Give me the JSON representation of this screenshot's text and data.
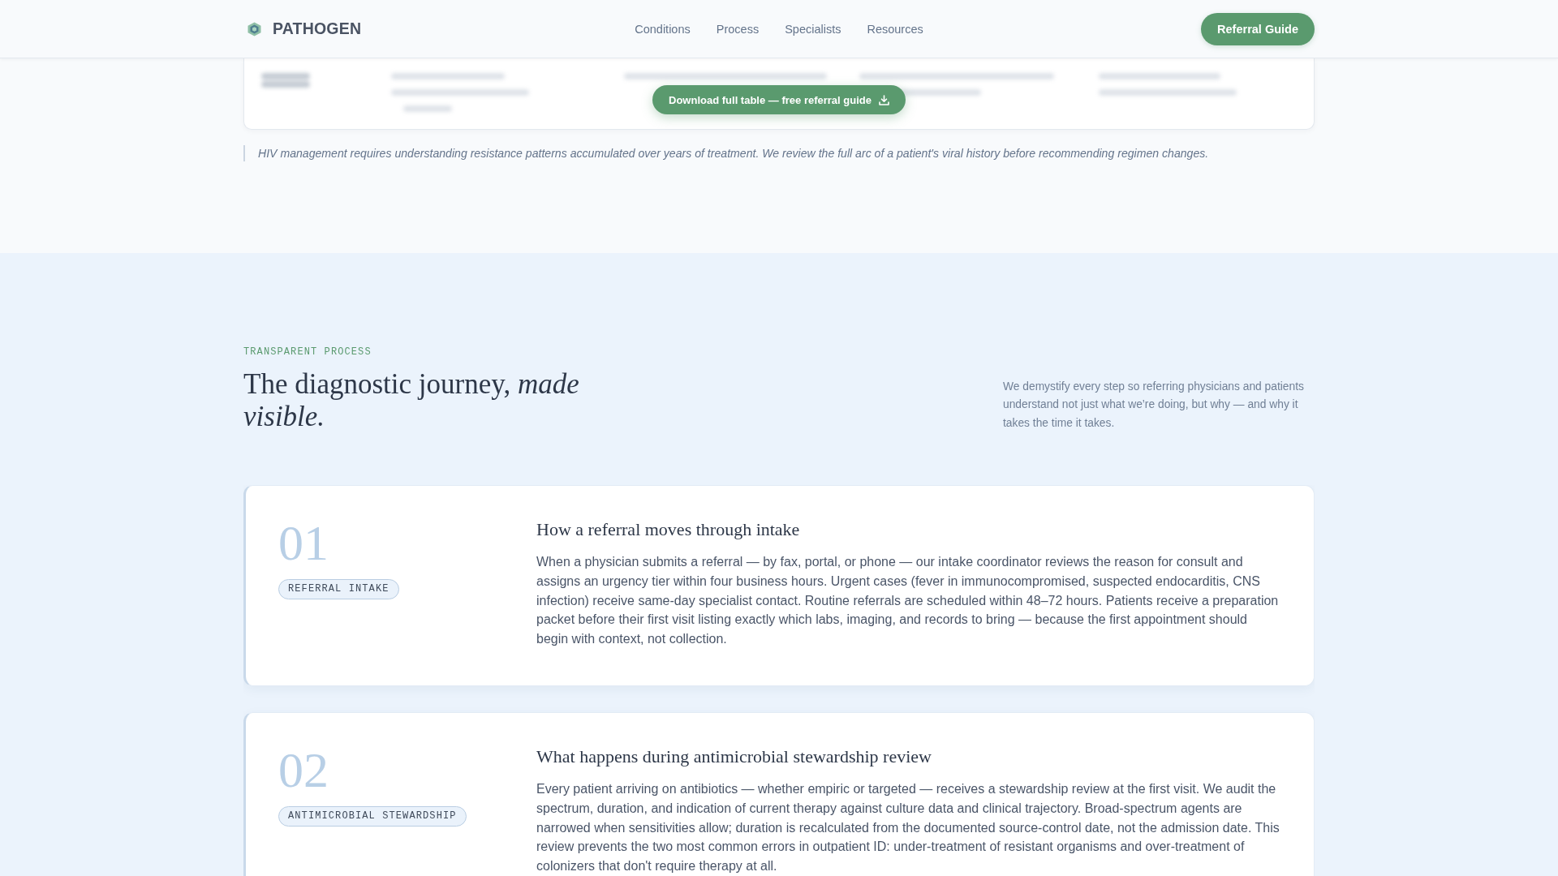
{
  "header": {
    "brand": "PATHOGEN",
    "nav": [
      {
        "label": "Conditions"
      },
      {
        "label": "Process"
      },
      {
        "label": "Specialists"
      },
      {
        "label": "Resources"
      }
    ],
    "cta": "Referral Guide"
  },
  "table_preview": {
    "download_button": "Download full table — free referral guide"
  },
  "note": "HIV management requires understanding resistance patterns accumulated over years of treatment. We review the full arc of a patient's viral history before recommending regimen changes.",
  "process": {
    "eyebrow": "TRANSPARENT PROCESS",
    "heading": "The diagnostic journey, *made visible.*",
    "intro": "We demystify every step so referring physicians and patients understand not just what we’re doing, but why — and why it takes the time it takes.",
    "steps": [
      {
        "number": "01",
        "tag": "REFERRAL INTAKE",
        "title": "How a referral moves through intake",
        "body": "When a physician submits a referral — by fax, portal, or phone — our intake coordinator reviews the reason for consult and assigns an urgency tier within four business hours. Urgent cases (fever in immunocompromised, suspected endocarditis, CNS infection) receive same-day specialist contact. Routine referrals are scheduled within 48–72 hours. Patients receive a preparation packet before their first visit listing exactly which labs, imaging, and records to bring — because the first appointment should begin with context, not collection."
      },
      {
        "number": "02",
        "tag": "ANTIMICROBIAL STEWARDSHIP",
        "title": "What happens during antimicrobial stewardship review",
        "body": "Every patient arriving on antibiotics — whether empiric or targeted — receives a stewardship review at the first visit. We audit the spectrum, duration, and indication of current therapy against culture data and clinical trajectory. Broad-spectrum agents are narrowed when sensitivities allow; duration is recalculated from the documented source-control date, not the admission date. This review prevents the two most common errors in outpatient ID: under-treatment of resistant organisms and over-treatment of colonizers that don't require therapy at all."
      }
    ]
  }
}
